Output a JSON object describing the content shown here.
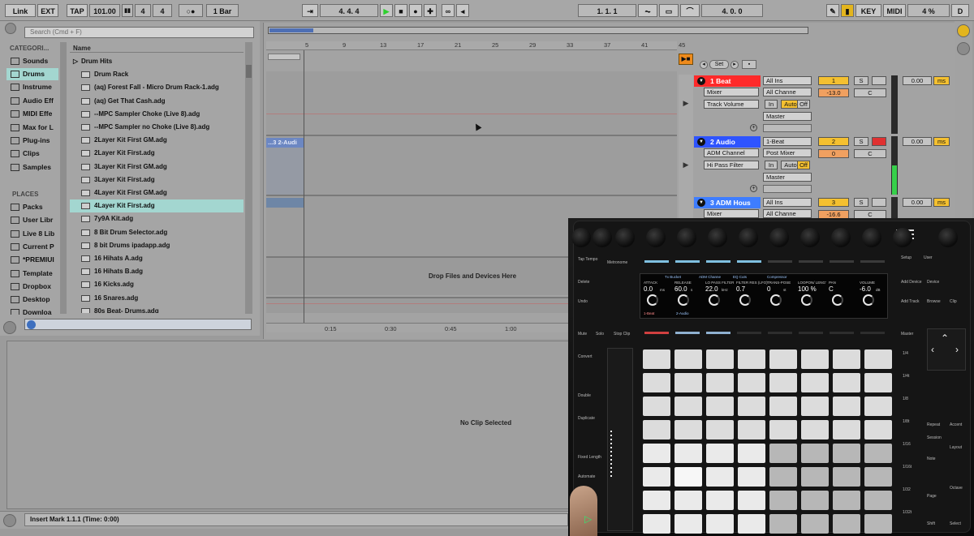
{
  "transport": {
    "link": "Link",
    "ext": "EXT",
    "tap": "TAP",
    "tempo": "101.00",
    "sig_num": "4",
    "sig_den": "4",
    "quant": "1 Bar",
    "position": "4. 4. 4",
    "loop_start": "1. 1. 1",
    "loop_len": "4. 0. 0",
    "key": "KEY",
    "midi": "MIDI",
    "cpu": "4 %",
    "d": "D"
  },
  "browser": {
    "search_placeholder": "Search (Cmd + F)",
    "categories_header": "CATEGORI...",
    "name_header": "Name",
    "places_header": "PLACES",
    "categories": [
      "Sounds",
      "Drums",
      "Instrume",
      "Audio Eff",
      "MIDI Effe",
      "Max for L",
      "Plug-ins",
      "Clips",
      "Samples"
    ],
    "places": [
      "Packs",
      "User Libr",
      "Live 8 Lib",
      "Current P",
      "*PREMIUI",
      "Template",
      "Dropbox",
      "Desktop",
      "Downloa"
    ],
    "files": [
      "Drum Hits",
      "Drum Rack",
      "(aq) Forest Fall - Micro Drum Rack-1.adg",
      "(aq) Get That Cash.adg",
      "--MPC Sampler Choke (Live 8).adg",
      "--MPC Sampler no Choke (Live 8).adg",
      "2Layer Kit First GM.adg",
      "2Layer Kit First.adg",
      "3Layer Kit First GM.adg",
      "3Layer Kit First.adg",
      "4Layer Kit First GM.adg",
      "4Layer Kit First.adg",
      "7y9A Kit.adg",
      "8 Bit Drum Selector.adg",
      "8 bit Drums ipadapp.adg",
      "16 Hihats A.adg",
      "16 Hihats B.adg",
      "16 Kicks.adg",
      "16 Snares.adg",
      "80s Beat- Drums.adg"
    ]
  },
  "arrangement": {
    "bar_ticks": [
      "5",
      "9",
      "13",
      "17",
      "21",
      "25",
      "29",
      "33",
      "37",
      "41",
      "45"
    ],
    "time_ticks": [
      "0:15",
      "0:30",
      "0:45",
      "1:00"
    ],
    "clip_label": "...3 2-Audi",
    "drop_hint": "Drop Files and Devices Here",
    "set_label": "Set"
  },
  "tracks": [
    {
      "name": "1 Beat",
      "color": "#ff2a2a",
      "input": "All Ins",
      "channel": "All Channe",
      "mixer": "Mixer",
      "param": "Track Volume",
      "monitor": [
        "In",
        "Auto",
        "Off"
      ],
      "output": "Master",
      "num": "1",
      "s": "S",
      "vol": "-13.0",
      "pan": "C",
      "send": "0.00",
      "ms": "ms"
    },
    {
      "name": "2 Audio",
      "color": "#2e54ff",
      "input": "1-Beat",
      "channel": "Post Mixer",
      "mixer": "ADM Channel",
      "param": "Hi Pass Filter",
      "monitor": [
        "In",
        "Auto",
        "Off"
      ],
      "output": "Master",
      "num": "2",
      "s": "S",
      "vol": "0",
      "pan": "C",
      "send": "0.00",
      "ms": "ms"
    },
    {
      "name": "3 ADM Hous",
      "color": "#3e7dff",
      "input": "All Ins",
      "channel": "All Channe",
      "mixer": "Mixer",
      "num": "3",
      "s": "S",
      "vol": "-16.6",
      "pan": "C",
      "send": "0.00",
      "ms": "ms"
    }
  ],
  "detail": {
    "no_clip": "No Clip Selected"
  },
  "status": {
    "text": "Insert Mark 1.1.1 (Time: 0:00)"
  },
  "push": {
    "left_labels": [
      "Tap Tempo",
      "Metronome",
      "Delete",
      "Undo",
      "Mute",
      "Solo",
      "Stop Clip",
      "Convert",
      "Double",
      "Duplicate",
      "Fixed Length",
      "Automate"
    ],
    "right_labels": [
      "Setup",
      "User",
      "Add Device",
      "Add Track",
      "Device",
      "Browse",
      "Clip",
      "Master",
      "Repeat",
      "Accent",
      "Layout",
      "Note",
      "Session",
      "Page",
      "Octave",
      "Shift",
      "Select"
    ],
    "grid_labels": [
      "1/4",
      "1/4t",
      "1/8",
      "1/8t",
      "1/16",
      "1/16t",
      "1/32",
      "1/32t"
    ],
    "screen_tabs": [
      "Tx Bucket",
      "ADM Channe",
      "EQ Cuts",
      "Compressor"
    ],
    "screen_params": [
      {
        "name": "ATTACK",
        "value": "0.0",
        "unit": "ms"
      },
      {
        "name": "RELEASE",
        "value": "60.0",
        "unit": "s"
      },
      {
        "name": "LO PASS FILTER",
        "value": "22.0",
        "unit": "kHz"
      },
      {
        "name": "FILTER RES (LFO)",
        "value": "0.7",
        "unit": ""
      },
      {
        "name": "TRANS-POSE",
        "value": "0",
        "unit": "st"
      },
      {
        "name": "LOOPON/ LENG'",
        "value": "100 %",
        "unit": ""
      },
      {
        "name": "PAN",
        "value": "C",
        "unit": ""
      },
      {
        "name": "VOLUME",
        "value": "-6.0",
        "unit": "dB"
      }
    ],
    "screen_tracks": [
      "1-Beat",
      "2-Audio"
    ]
  }
}
